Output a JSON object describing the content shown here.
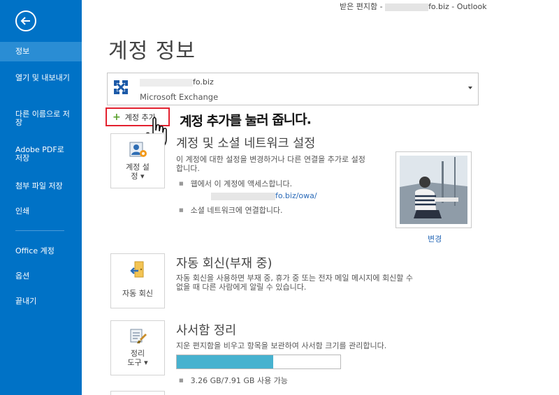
{
  "window": {
    "title_prefix": "받은 편지함 - ",
    "title_suffix": "fo.biz - Outlook"
  },
  "sidebar": {
    "back_icon": "back-arrow-icon",
    "items": [
      {
        "label": "정보",
        "active": true
      },
      {
        "label": "열기 및 내보내기"
      },
      {
        "label": "다른 이름으로 저장"
      },
      {
        "label": "Adobe PDF로 저장"
      },
      {
        "label": "첨부 파일 저장"
      },
      {
        "label": "인쇄"
      },
      {
        "label": "Office 계정"
      },
      {
        "label": "옵션"
      },
      {
        "label": "끝내기"
      }
    ]
  },
  "page": {
    "title": "계정 정보"
  },
  "account": {
    "email_suffix": "fo.biz",
    "type": "Microsoft Exchange",
    "icon": "exchange-icon"
  },
  "add_account": {
    "label": "계정 추가",
    "icon": "plus-icon"
  },
  "annotation": {
    "text": "계정 추가를 눌러 줍니다."
  },
  "account_settings": {
    "button_label_1": "계정 설",
    "button_label_2": "정 ▾",
    "title": "계정 및 소셜 네트워크 설정",
    "desc_1": "이 계정에 대한 설정을 변경하거나 다른 연결을 추가로 설정",
    "desc_2": "합니다.",
    "bullet_web": "웹에서 이 계정에 액세스합니다.",
    "owa_link_suffix": "fo.biz/owa/",
    "bullet_social": "소셜 네트워크에 연결합니다.",
    "change_label": "변경"
  },
  "auto_reply": {
    "button_label": "자동 회신",
    "title": "자동 회신(부재 중)",
    "desc_1": "자동 회신을 사용하면 부재 중, 휴가 중 또는 전자 메일 메시지에 회신할 수",
    "desc_2": "없을 때 다른 사람에게 알릴 수 있습니다."
  },
  "mailbox_cleanup": {
    "button_label_1": "정리",
    "button_label_2": "도구 ▾",
    "title": "사서함 정리",
    "desc": "지운 편지함을 비우고 항목을 보관하여 사서함 크기를 관리합니다.",
    "usage_fraction": 0.588,
    "usage_text": "3.26 GB/7.91 GB 사용 가능"
  },
  "colors": {
    "sidebar": "#0072c6",
    "sidebar_active": "#2a8dd4",
    "link": "#2a6ab8",
    "highlight_border": "#e3212f",
    "progress": "#47b2cf"
  }
}
